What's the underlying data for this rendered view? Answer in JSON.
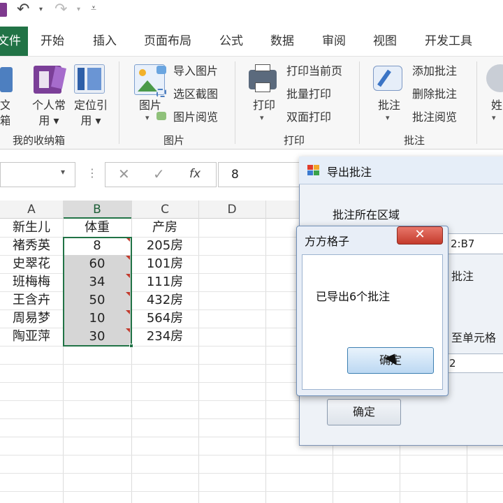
{
  "ribbon_tabs": {
    "file": "文件",
    "home": "开始",
    "insert": "插入",
    "layout": "页面布局",
    "formulas": "公式",
    "data": "数据",
    "review": "审阅",
    "view": "视图",
    "developer": "开发工具"
  },
  "ribbon": {
    "left_cut_top": "文",
    "left_cut_bottom": "箱",
    "personal_label_1": "个人常",
    "personal_label_2": "用",
    "locate_label_1": "定位引",
    "locate_label_2": "用",
    "group_box": "我的收纳箱",
    "picture_label": "图片",
    "insert_picture": "导入图片",
    "region_capture": "选区截图",
    "picture_browse": "图片阅览",
    "group_picture": "图片",
    "print_label": "打印",
    "print_current": "打印当前页",
    "batch_print": "批量打印",
    "duplex_print": "双面打印",
    "group_print": "打印",
    "comment_label": "批注",
    "add_comment": "添加批注",
    "delete_comment": "删除批注",
    "comment_browse": "批注阅览",
    "group_comment": "批注",
    "right_cut": "姓"
  },
  "formula_bar": {
    "fx": "fx",
    "value": "8"
  },
  "sheet": {
    "columns": [
      "A",
      "B",
      "C",
      "D"
    ],
    "headers": {
      "a": "新生儿",
      "b": "体重",
      "c": "产房"
    },
    "rows": [
      {
        "a": "褚秀英",
        "b": "8",
        "c": "205房"
      },
      {
        "a": "史翠花",
        "b": "60",
        "c": "101房"
      },
      {
        "a": "班梅梅",
        "b": "34",
        "c": "111房"
      },
      {
        "a": "王含卉",
        "b": "50",
        "c": "432房"
      },
      {
        "a": "周易梦",
        "b": "10",
        "c": "564房"
      },
      {
        "a": "陶亚萍",
        "b": "30",
        "c": "234房"
      }
    ]
  },
  "export_dialog": {
    "title": "导出批注",
    "region_label": "批注所在区域",
    "region_value": "2:B7",
    "partial_comment": "批注",
    "partial_cell": "至单元格",
    "partial_value": "2",
    "ok": "确定"
  },
  "message_box": {
    "title": "方方格子",
    "message": "已导出6个批注",
    "ok": "确定",
    "close": "✕"
  }
}
